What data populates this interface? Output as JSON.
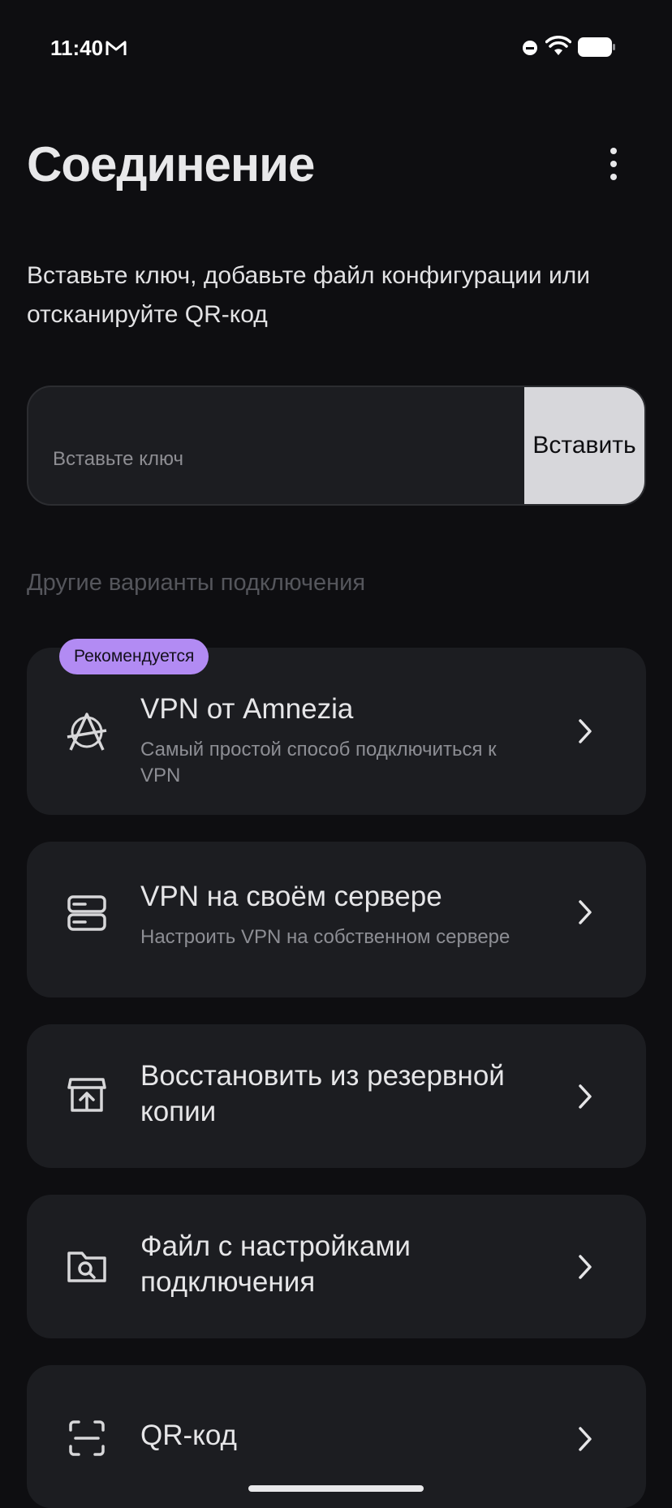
{
  "status_bar": {
    "time": "11:40",
    "icons": [
      "gmail-icon",
      "do-not-disturb-icon",
      "wifi-icon",
      "battery-icon"
    ]
  },
  "header": {
    "title": "Соединение",
    "menu_icon": "more-vertical-icon"
  },
  "description": "Вставьте ключ, добавьте файл конфигурации или отсканируйте QR-код",
  "key_field": {
    "placeholder": "Вставьте ключ",
    "value": "",
    "paste_label": "Вставить"
  },
  "section_label": "Другие варианты подключения",
  "options": [
    {
      "badge": "Рекомендуется",
      "title": "VPN от Amnezia",
      "subtitle": "Самый простой способ подключиться к VPN",
      "icon": "amnezia-logo-icon"
    },
    {
      "title": "VPN на своём сервере",
      "subtitle": "Настроить VPN на собственном сервере",
      "icon": "server-icon"
    },
    {
      "title": "Восстановить из резервной копии",
      "icon": "backup-restore-icon"
    },
    {
      "title": "Файл с настройками подключения",
      "icon": "folder-search-icon"
    },
    {
      "title": "QR-код",
      "icon": "qr-scan-icon"
    }
  ],
  "colors": {
    "background": "#0e0e11",
    "card": "#1c1d21",
    "badge": "#b28bf3",
    "paste_button": "#d7d7db"
  }
}
